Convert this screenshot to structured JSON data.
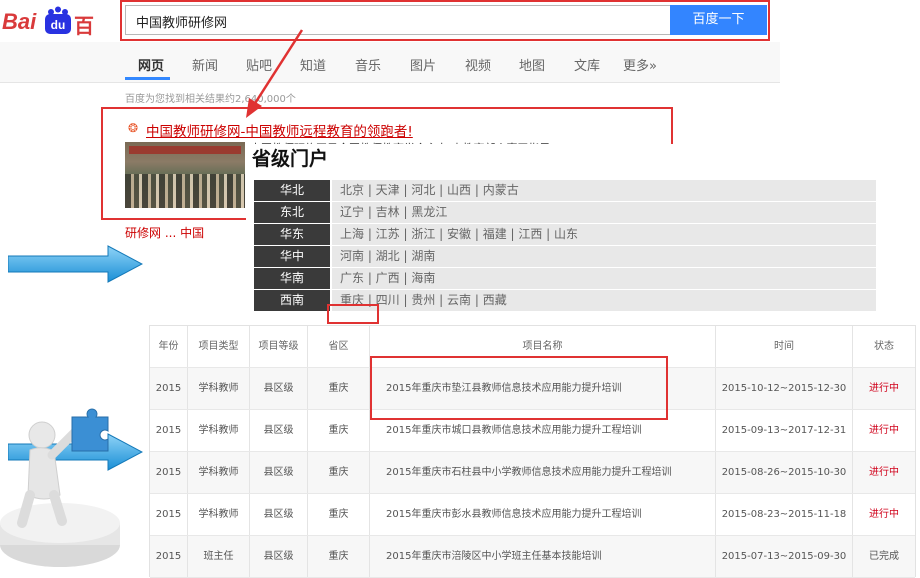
{
  "baidu": {
    "logo": {
      "bai": "Bai",
      "du": "百度"
    },
    "search_value": "中国教师研修网",
    "search_button": "百度一下",
    "tabs": [
      "网页",
      "新闻",
      "贴吧",
      "知道",
      "音乐",
      "图片",
      "视频",
      "地图",
      "文库",
      "更多»"
    ],
    "result_count": "百度为您找到相关结果约2,640,000个",
    "result_title": "中国教师研修网-中国教师远程教育的领跑者!",
    "result_snippet": "中国教师研修网是全国教师教育学会主办 由教育部人事司指导",
    "next_result_partial": "研修网 ... 中国"
  },
  "portal": {
    "title": "省级门户",
    "rows": [
      {
        "region": "华北",
        "provinces": "北京 | 天津 | 河北 | 山西 | 内蒙古"
      },
      {
        "region": "东北",
        "provinces": "辽宁 | 吉林 | 黑龙江"
      },
      {
        "region": "华东",
        "provinces": "上海 | 江苏 | 浙江 | 安徽 | 福建 | 江西 | 山东"
      },
      {
        "region": "华中",
        "provinces": "河南 | 湖北 | 湖南"
      },
      {
        "region": "华南",
        "provinces": "广东 | 广西 | 海南"
      },
      {
        "region": "西南",
        "provinces": "重庆 | 四川 | 贵州 | 云南 | 西藏"
      }
    ]
  },
  "projects": {
    "headers": [
      "年份",
      "项目类型",
      "项目等级",
      "省区",
      "项目名称",
      "时间",
      "状态"
    ],
    "rows": [
      [
        "2015",
        "学科教师",
        "县区级",
        "重庆",
        "2015年重庆市垫江县教师信息技术应用能力提升培训",
        "2015-10-12~2015-12-30",
        "进行中"
      ],
      [
        "2015",
        "学科教师",
        "县区级",
        "重庆",
        "2015年重庆市城口县教师信息技术应用能力提升工程培训",
        "2015-09-13~2017-12-31",
        "进行中"
      ],
      [
        "2015",
        "学科教师",
        "县区级",
        "重庆",
        "2015年重庆市石柱县中小学教师信息技术应用能力提升工程培训",
        "2015-08-26~2015-10-30",
        "进行中"
      ],
      [
        "2015",
        "学科教师",
        "县区级",
        "重庆",
        "2015年重庆市彭水县教师信息技术应用能力提升工程培训",
        "2015-08-23~2015-11-18",
        "进行中"
      ],
      [
        "2015",
        "班主任",
        "县区级",
        "重庆",
        "2015年重庆市涪陵区中小学班主任基本技能培训",
        "2015-07-13~2015-09-30",
        "已完成"
      ]
    ]
  },
  "colors": {
    "accent": "#3385ff",
    "highlight": "#e03232",
    "status_active": "#d0021b",
    "region_bg": "#3a3a3a"
  }
}
